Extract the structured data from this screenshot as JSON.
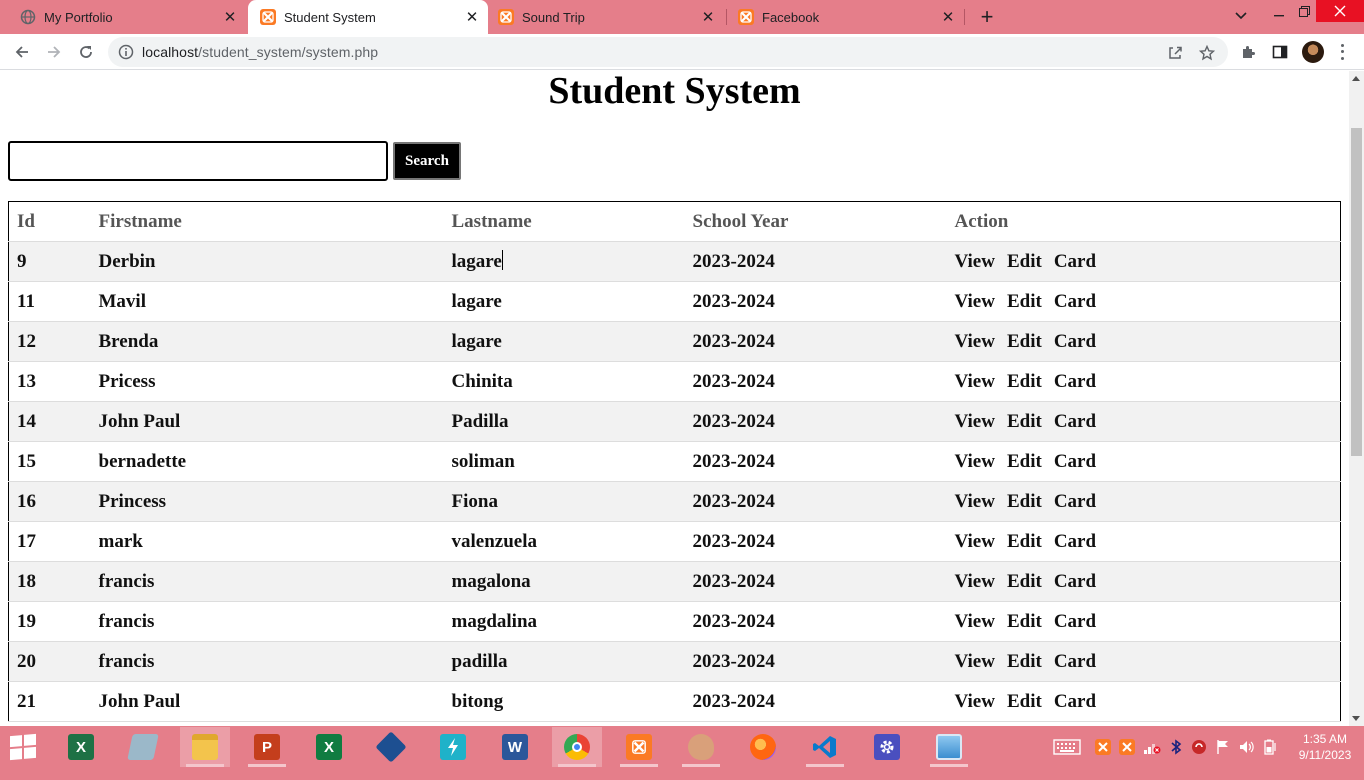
{
  "browser": {
    "tabs": [
      {
        "title": "My Portfolio",
        "icon": "globe-icon",
        "active": false
      },
      {
        "title": "Student System",
        "icon": "xampp-icon",
        "active": true
      },
      {
        "title": "Sound Trip",
        "icon": "xampp-icon",
        "active": false
      },
      {
        "title": "Facebook",
        "icon": "xampp-icon",
        "active": false
      }
    ],
    "close_glyph": "✕",
    "new_tab_glyph": "+",
    "url_host": "localhost",
    "url_path": "/student_system/system.php"
  },
  "page": {
    "title": "Student System",
    "search": {
      "value": "",
      "placeholder": ""
    },
    "search_button": "Search",
    "columns": [
      "Id",
      "Firstname",
      "Lastname",
      "School Year",
      "Action"
    ],
    "action_labels": {
      "view": "View",
      "edit": "Edit",
      "card": "Card"
    },
    "rows": [
      {
        "id": "9",
        "first": "Derbin",
        "last": "lagare",
        "year": "2023-2024"
      },
      {
        "id": "11",
        "first": "Mavil",
        "last": "lagare",
        "year": "2023-2024"
      },
      {
        "id": "12",
        "first": "Brenda",
        "last": "lagare",
        "year": "2023-2024"
      },
      {
        "id": "13",
        "first": "Pricess",
        "last": "Chinita",
        "year": "2023-2024"
      },
      {
        "id": "14",
        "first": "John Paul",
        "last": "Padilla",
        "year": "2023-2024"
      },
      {
        "id": "15",
        "first": "bernadette",
        "last": "soliman",
        "year": "2023-2024"
      },
      {
        "id": "16",
        "first": "Princess",
        "last": "Fiona",
        "year": "2023-2024"
      },
      {
        "id": "17",
        "first": "mark",
        "last": "valenzuela",
        "year": "2023-2024"
      },
      {
        "id": "18",
        "first": "francis",
        "last": "magalona",
        "year": "2023-2024"
      },
      {
        "id": "19",
        "first": "francis",
        "last": "magdalina",
        "year": "2023-2024"
      },
      {
        "id": "20",
        "first": "francis",
        "last": "padilla",
        "year": "2023-2024"
      },
      {
        "id": "21",
        "first": "John Paul",
        "last": "bitong",
        "year": "2023-2024"
      }
    ]
  },
  "taskbar": {
    "apps": [
      {
        "name": "excel-app-icon",
        "label": "X",
        "color": "#1e7145"
      },
      {
        "name": "notepad-app-icon",
        "label": "",
        "color": "#9bb8c9"
      },
      {
        "name": "file-explorer-icon",
        "label": "",
        "color": "#f3c44c"
      },
      {
        "name": "powerpoint-icon",
        "label": "P",
        "color": "#c43e1c"
      },
      {
        "name": "excel-icon",
        "label": "X",
        "color": "#107c41"
      },
      {
        "name": "virtualbox-icon",
        "label": "",
        "color": "#1d4f91"
      },
      {
        "name": "sourcetree-icon",
        "label": "",
        "color": "#1fb2c9"
      },
      {
        "name": "word-icon",
        "label": "W",
        "color": "#2b579a"
      },
      {
        "name": "chrome-icon",
        "label": "",
        "color": "#4285f4"
      },
      {
        "name": "xampp-icon",
        "label": "",
        "color": "#fb7a24"
      },
      {
        "name": "paint-icon",
        "label": "",
        "color": "#d9a07a"
      },
      {
        "name": "firefox-icon",
        "label": "",
        "color": "#ff6611"
      },
      {
        "name": "vscode-icon",
        "label": "",
        "color": "#0a7acc"
      },
      {
        "name": "settings-icon",
        "label": "",
        "color": "#4a4fbf"
      },
      {
        "name": "photos-icon",
        "label": "",
        "color": "#3b8ed0"
      }
    ],
    "time": "1:35 AM",
    "date": "9/11/2023"
  }
}
